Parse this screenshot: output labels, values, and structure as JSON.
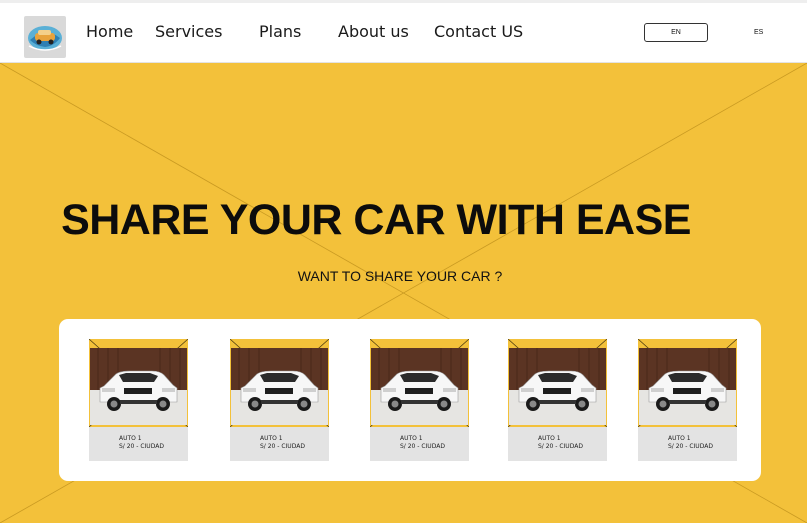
{
  "nav": {
    "items": [
      "Home",
      "Services",
      "Plans",
      "About us",
      "Contact US"
    ]
  },
  "lang": {
    "en": "EN",
    "es": "ES"
  },
  "hero": {
    "title": "SHARE YOUR CAR WITH EASE",
    "subtitle": "WANT TO SHARE YOUR CAR ?"
  },
  "cards": [
    {
      "name": "AUTO 1",
      "price": "S/ 20 - CIUDAD"
    },
    {
      "name": "AUTO 1",
      "price": "S/ 20 - CIUDAD"
    },
    {
      "name": "AUTO 1",
      "price": "S/ 20 - CIUDAD"
    },
    {
      "name": "AUTO 1",
      "price": "S/ 20 - CIUDAD"
    },
    {
      "name": "AUTO 1",
      "price": "S/ 20 - CIUDAD"
    }
  ],
  "colors": {
    "accent": "#f3c13a",
    "panel": "#ffffff",
    "caption": "#e3e3e3"
  },
  "icons": {
    "logo": "car-logo-icon",
    "photo": "suv-car-image"
  }
}
